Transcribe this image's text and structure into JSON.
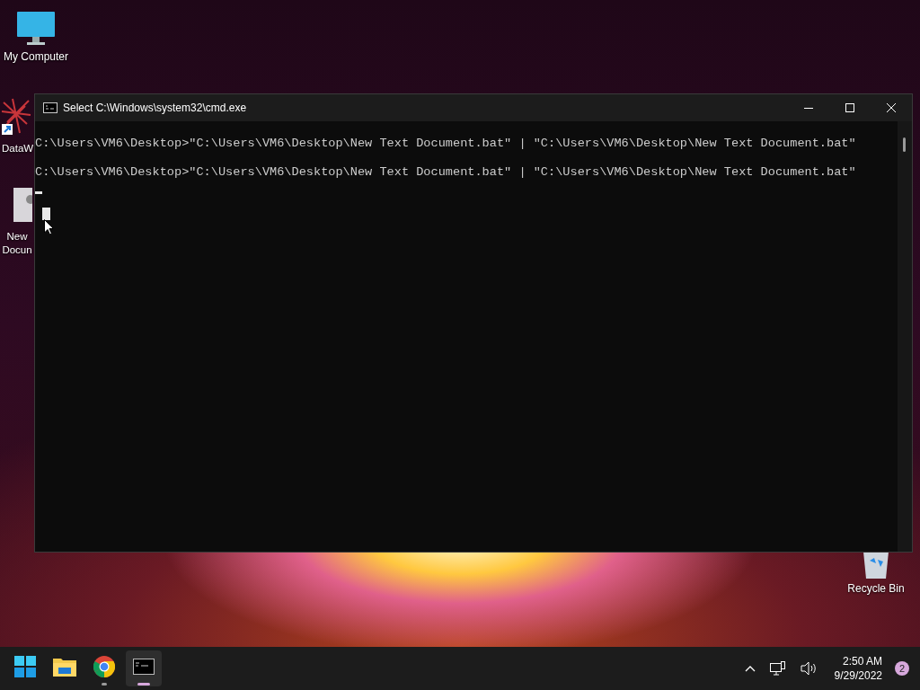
{
  "desktop_icons": [
    {
      "kind": "computer",
      "label": "My Computer"
    },
    {
      "kind": "shortcut",
      "label": "DataW"
    },
    {
      "kind": "document",
      "label": "New Docun"
    },
    {
      "kind": "recycle",
      "label": "Recycle Bin"
    }
  ],
  "window": {
    "title": "Select C:\\Windows\\system32\\cmd.exe",
    "lines": [
      "C:\\Users\\VM6\\Desktop>\"C:\\Users\\VM6\\Desktop\\New Text Document.bat\" | \"C:\\Users\\VM6\\Desktop\\New Text Document.bat\"",
      "C:\\Users\\VM6\\Desktop>\"C:\\Users\\VM6\\Desktop\\New Text Document.bat\" | \"C:\\Users\\VM6\\Desktop\\New Text Document.bat\""
    ]
  },
  "taskbar": {
    "apps": [
      {
        "kind": "start",
        "running": false,
        "selected": false
      },
      {
        "kind": "explorer",
        "running": false,
        "selected": false
      },
      {
        "kind": "chrome",
        "running": true,
        "selected": false
      },
      {
        "kind": "terminal",
        "running": true,
        "selected": true
      }
    ],
    "time": "2:50 AM",
    "date": "9/29/2022",
    "notifications": "2"
  }
}
